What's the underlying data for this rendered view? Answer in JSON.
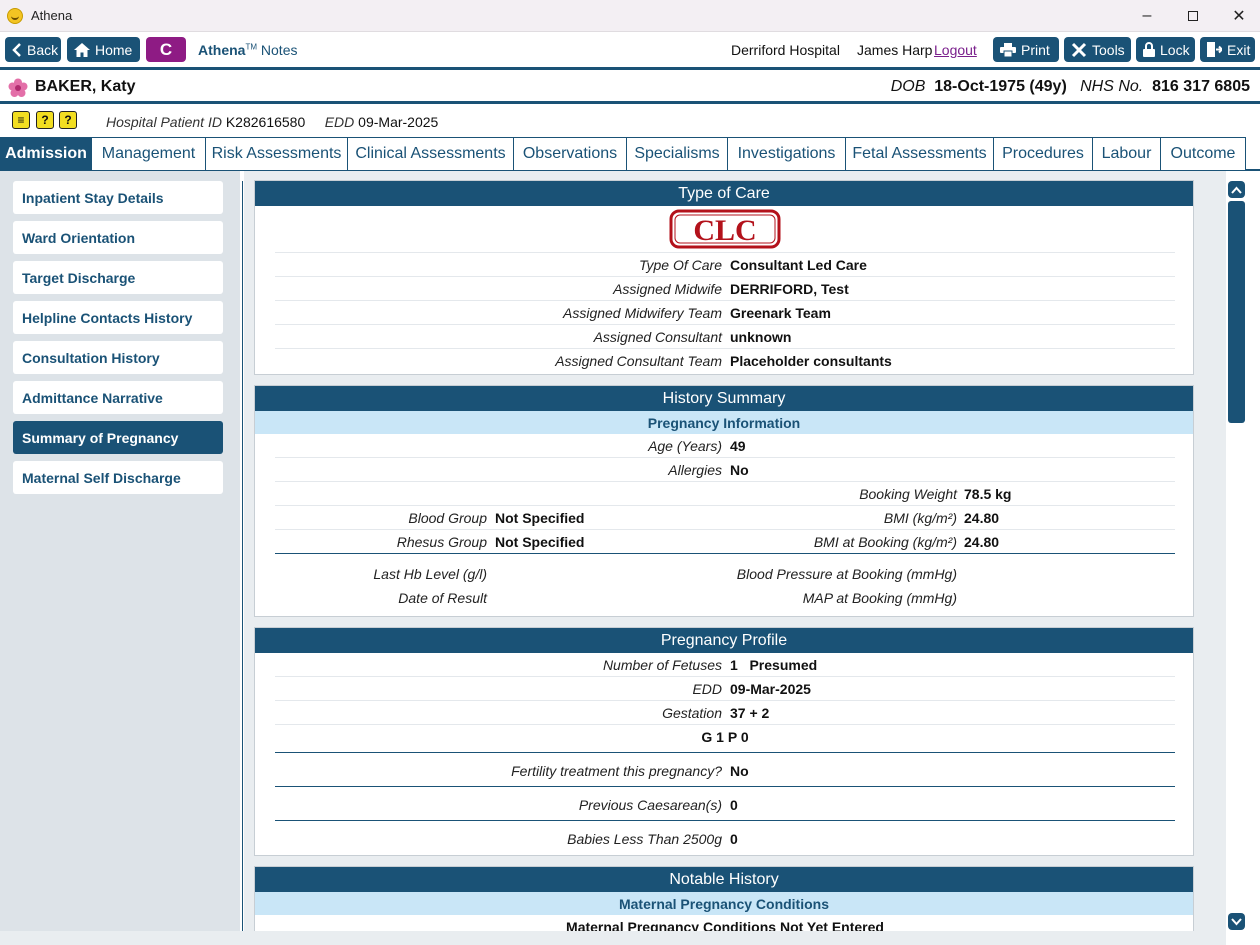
{
  "window": {
    "title": "Athena"
  },
  "toolbar": {
    "back": "Back",
    "home": "Home",
    "c_button": "C",
    "app_name": "Athena",
    "app_trademark": "TM",
    "app_sub": "Notes",
    "hospital": "Derriford Hospital",
    "user": "James Harp",
    "logout": "Logout",
    "print": "Print",
    "tools": "Tools",
    "lock": "Lock",
    "exit": "Exit"
  },
  "patient": {
    "name": "BAKER, Katy",
    "dob_label": "DOB",
    "dob": "18-Oct-1975 (49y)",
    "nhs_label": "NHS No.",
    "nhs": "816 317 6805",
    "hpid_label": "Hospital Patient ID",
    "hpid": "K282616580",
    "edd_label": "EDD",
    "edd": "09-Mar-2025"
  },
  "tabs": [
    "Admission",
    "Management",
    "Risk Assessments",
    "Clinical Assessments",
    "Observations",
    "Specialisms",
    "Investigations",
    "Fetal Assessments",
    "Procedures",
    "Labour",
    "Outcome"
  ],
  "sidebar": {
    "items": [
      "Inpatient Stay Details",
      "Ward Orientation",
      "Target Discharge",
      "Helpline Contacts History",
      "Consultation History",
      "Admittance Narrative",
      "Summary of Pregnancy",
      "Maternal Self Discharge"
    ]
  },
  "type_of_care": {
    "header": "Type of Care",
    "stamp": "CLC",
    "rows": [
      {
        "label": "Type Of Care",
        "value": "Consultant Led Care"
      },
      {
        "label": "Assigned Midwife",
        "value": "DERRIFORD, Test"
      },
      {
        "label": "Assigned Midwifery Team",
        "value": "Greenark Team"
      },
      {
        "label": "Assigned Consultant",
        "value": "unknown"
      },
      {
        "label": "Assigned Consultant Team",
        "value": "Placeholder consultants"
      }
    ]
  },
  "history": {
    "header": "History Summary",
    "sub": "Pregnancy Information",
    "age_label": "Age (Years)",
    "age": "49",
    "allergies_label": "Allergies",
    "allergies": "No",
    "booking_weight_label": "Booking Weight",
    "booking_weight": "78.5 kg",
    "blood_group_label": "Blood Group",
    "blood_group": "Not Specified",
    "bmi_label": "BMI (kg/m²)",
    "bmi": "24.80",
    "rhesus_label": "Rhesus Group",
    "rhesus": "Not Specified",
    "bmi_booking_label": "BMI at Booking (kg/m²)",
    "bmi_booking": "24.80",
    "hb_label": "Last Hb Level (g/l)",
    "bp_label": "Blood Pressure at Booking (mmHg)",
    "date_result_label": "Date of Result",
    "map_label": "MAP at Booking (mmHg)"
  },
  "profile": {
    "header": "Pregnancy Profile",
    "fetuses_label": "Number of Fetuses",
    "fetuses": "1",
    "fetuses_status": "Presumed",
    "edd_label": "EDD",
    "edd": "09-Mar-2025",
    "gestation_label": "Gestation",
    "gestation": "37 + 2",
    "gp": "G 1 P 0",
    "fertility_label": "Fertility treatment this pregnancy?",
    "fertility": "No",
    "caesarean_label": "Previous Caesarean(s)",
    "caesarean": "0",
    "babies_label": "Babies Less Than 2500g",
    "babies": "0"
  },
  "notable": {
    "header": "Notable History",
    "sub": "Maternal Pregnancy Conditions",
    "text": "Maternal Pregnancy Conditions Not Yet Entered"
  },
  "colors": {
    "primary": "#1a5276",
    "accent": "#8e1b84",
    "light": "#c9e6f7",
    "stamp": "#b3121b"
  }
}
